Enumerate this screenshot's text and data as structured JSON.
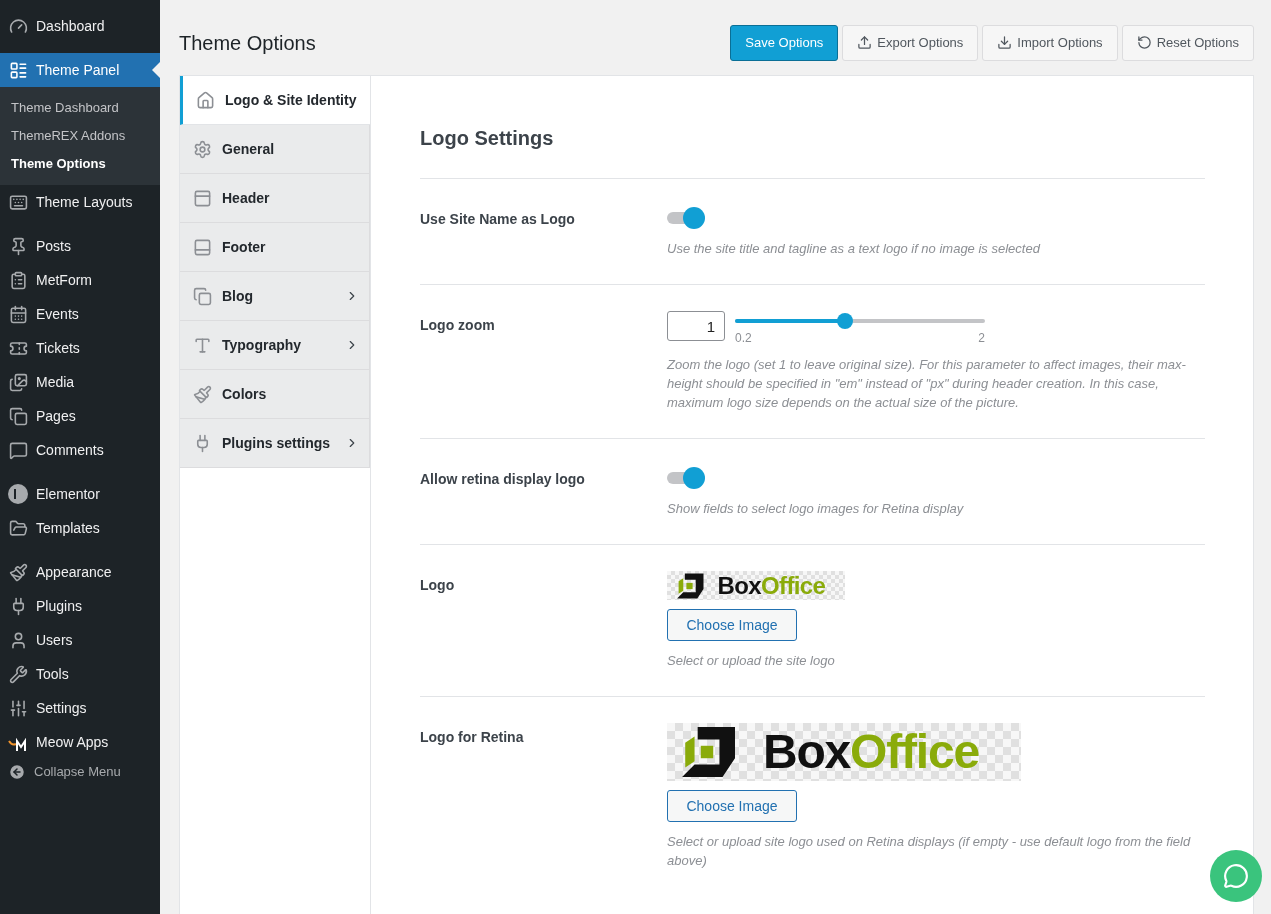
{
  "sidebar": {
    "groups": [
      {
        "items": [
          {
            "label": "Dashboard",
            "selected": false
          }
        ]
      },
      {
        "items": [
          {
            "label": "Theme Panel",
            "selected": true,
            "children": [
              {
                "label": "Theme Dashboard",
                "selected": false
              },
              {
                "label": "ThemeREX Addons",
                "selected": false
              },
              {
                "label": "Theme Options",
                "selected": true
              }
            ]
          },
          {
            "label": "Theme Layouts",
            "selected": false
          }
        ]
      },
      {
        "items": [
          {
            "label": "Posts",
            "selected": false
          },
          {
            "label": "MetForm",
            "selected": false
          },
          {
            "label": "Events",
            "selected": false
          },
          {
            "label": "Tickets",
            "selected": false
          },
          {
            "label": "Media",
            "selected": false
          },
          {
            "label": "Pages",
            "selected": false
          },
          {
            "label": "Comments",
            "selected": false
          }
        ]
      },
      {
        "items": [
          {
            "label": "Elementor",
            "selected": false
          },
          {
            "label": "Templates",
            "selected": false
          }
        ]
      },
      {
        "items": [
          {
            "label": "Appearance",
            "selected": false
          },
          {
            "label": "Plugins",
            "selected": false
          },
          {
            "label": "Users",
            "selected": false
          },
          {
            "label": "Tools",
            "selected": false
          },
          {
            "label": "Settings",
            "selected": false
          },
          {
            "label": "Meow Apps",
            "selected": false
          }
        ]
      }
    ],
    "collapse": "Collapse Menu"
  },
  "page": {
    "title": "Theme Options"
  },
  "buttons": [
    {
      "kind": "primary",
      "label": "Save Options"
    },
    {
      "kind": "secondary",
      "label": "Export Options"
    },
    {
      "kind": "secondary",
      "label": "Import Options"
    },
    {
      "kind": "secondary",
      "label": "Reset Options"
    }
  ],
  "tabs": [
    {
      "label": "Logo & Site Identity",
      "selected": true,
      "has_submenu": false
    },
    {
      "label": "General",
      "selected": false,
      "has_submenu": false
    },
    {
      "label": "Header",
      "selected": false,
      "has_submenu": false
    },
    {
      "label": "Footer",
      "selected": false,
      "has_submenu": false
    },
    {
      "label": "Blog",
      "selected": false,
      "has_submenu": true
    },
    {
      "label": "Typography",
      "selected": false,
      "has_submenu": true
    },
    {
      "label": "Colors",
      "selected": false,
      "has_submenu": false
    },
    {
      "label": "Plugins settings",
      "selected": false,
      "has_submenu": true
    }
  ],
  "section": {
    "title": "Logo Settings",
    "settings": [
      {
        "kind": "toggle",
        "label": "Use Site Name as Logo",
        "on": true,
        "description": "Use the site title and tagline as a text logo if no image is selected"
      },
      {
        "kind": "slider",
        "label": "Logo zoom",
        "value": "1",
        "level": 0.44,
        "min_label": "0.2",
        "max_label": "2",
        "description": "Zoom the logo (set 1 to leave original size). For this parameter to affect images, their max-height should be specified in \"em\" instead of \"px\" during header creation. In this case, maximum logo size depends on the actual size of the picture."
      },
      {
        "kind": "toggle",
        "label": "Allow retina display logo",
        "on": true,
        "description": "Show fields to select logo images for Retina display"
      },
      {
        "kind": "image",
        "label": "Logo",
        "logo_text": [
          "Box",
          "Office"
        ],
        "button": "Choose Image",
        "description": "Select or upload the site logo"
      },
      {
        "kind": "retina",
        "label": "Logo for Retina",
        "logo_text": [
          "Box",
          "Office"
        ],
        "button": "Choose Image",
        "description": "Select or upload site logo used on Retina displays (if empty - use default logo from the field above)"
      }
    ]
  }
}
